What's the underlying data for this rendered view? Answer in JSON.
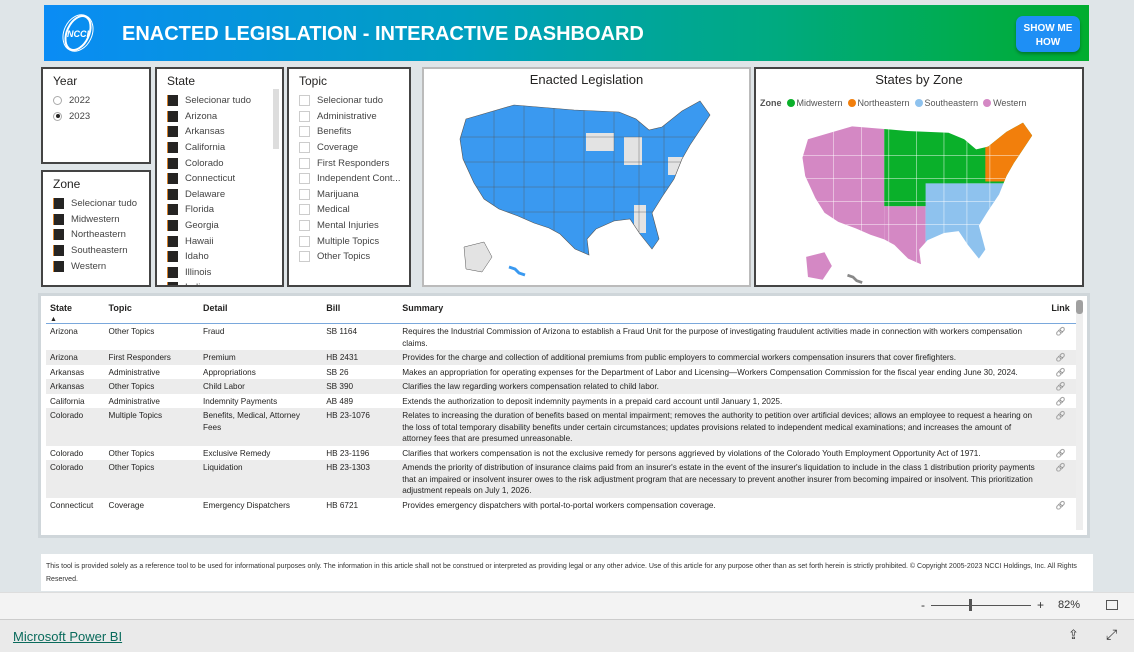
{
  "header": {
    "title": "ENACTED LEGISLATION - INTERACTIVE DASHBOARD",
    "logo_text": "NCCI",
    "show_me_line1": "SHOW ME",
    "show_me_line2": "HOW",
    "gradient_start": "#0a8cf5",
    "gradient_end": "#00ad2e"
  },
  "year": {
    "title": "Year",
    "options": [
      {
        "label": "2022",
        "selected": false
      },
      {
        "label": "2023",
        "selected": true
      }
    ]
  },
  "zone": {
    "title": "Zone",
    "items": [
      "Selecionar tudo",
      "Midwestern",
      "Northeastern",
      "Southeastern",
      "Western"
    ]
  },
  "state": {
    "title": "State",
    "items": [
      "Selecionar tudo",
      "Arizona",
      "Arkansas",
      "California",
      "Colorado",
      "Connecticut",
      "Delaware",
      "Florida",
      "Georgia",
      "Hawaii",
      "Idaho",
      "Illinois",
      "Indiana"
    ]
  },
  "topic": {
    "title": "Topic",
    "items": [
      "Selecionar tudo",
      "Administrative",
      "Benefits",
      "Coverage",
      "First Responders",
      "Independent Cont...",
      "Marijuana",
      "Medical",
      "Mental Injuries",
      "Multiple Topics",
      "Other Topics"
    ]
  },
  "enacted_map": {
    "title": "Enacted Legislation",
    "enacted_color": "#3a99f0",
    "not_enacted_color": "#e3e3e3"
  },
  "zone_map": {
    "title": "States by Zone",
    "legend_title": "Zone",
    "legend": [
      {
        "label": "Midwestern",
        "color": "#0ab02a"
      },
      {
        "label": "Northeastern",
        "color": "#f27f0c"
      },
      {
        "label": "Southeastern",
        "color": "#8ec2ee"
      },
      {
        "label": "Western",
        "color": "#d488c4"
      }
    ]
  },
  "table": {
    "headers": [
      "State",
      "Topic",
      "Detail",
      "Bill",
      "Summary",
      "Link"
    ],
    "sort_indicator": "▲",
    "rows": [
      {
        "state": "Arizona",
        "topic": "Other Topics",
        "detail": "Fraud",
        "bill": "SB 1164",
        "summary": "Requires the Industrial Commission of Arizona to establish a Fraud Unit for the purpose of investigating fraudulent activities made in connection with workers compensation claims."
      },
      {
        "state": "Arizona",
        "topic": "First Responders",
        "detail": "Premium",
        "bill": "HB 2431",
        "summary": "Provides for the charge and collection of additional premiums from public employers to commercial workers compensation insurers that cover firefighters."
      },
      {
        "state": "Arkansas",
        "topic": "Administrative",
        "detail": "Appropriations",
        "bill": "SB 26",
        "summary": "Makes an appropriation for operating expenses for the Department of Labor and Licensing—Workers Compensation Commission for the fiscal year ending June 30, 2024."
      },
      {
        "state": "Arkansas",
        "topic": "Other Topics",
        "detail": "Child Labor",
        "bill": "SB 390",
        "summary": "Clarifies the law regarding workers compensation related to child labor."
      },
      {
        "state": "California",
        "topic": "Administrative",
        "detail": "Indemnity Payments",
        "bill": "AB 489",
        "summary": "Extends the authorization to deposit indemnity payments in a prepaid card account until January 1, 2025."
      },
      {
        "state": "Colorado",
        "topic": "Multiple Topics",
        "detail": "Benefits, Medical, Attorney Fees",
        "bill": "HB 23-1076",
        "summary": "Relates to increasing the duration of benefits based on mental impairment; removes the authority to petition over artificial devices; allows an employee to request a hearing on the loss of total temporary disability benefits under certain circumstances; updates provisions related to independent medical examinations; and increases the amount of attorney fees that are presumed unreasonable."
      },
      {
        "state": "Colorado",
        "topic": "Other Topics",
        "detail": "Exclusive Remedy",
        "bill": "HB 23-1196",
        "summary": "Clarifies that workers compensation is not the exclusive remedy for persons aggrieved by violations of the Colorado Youth Employment Opportunity Act of 1971."
      },
      {
        "state": "Colorado",
        "topic": "Other Topics",
        "detail": "Liquidation",
        "bill": "HB 23-1303",
        "summary": "Amends the priority of distribution of insurance claims paid from an insurer's estate in the event of the insurer's liquidation to include in the class 1 distribution priority payments that an impaired or insolvent insurer owes to the risk adjustment program that are necessary to prevent another insurer from becoming impaired or insolvent. This prioritization adjustment repeals on July 1, 2026."
      },
      {
        "state": "Connecticut",
        "topic": "Coverage",
        "detail": "Emergency Dispatchers",
        "bill": "HB 6721",
        "summary": "Provides emergency dispatchers with portal-to-portal workers compensation coverage."
      }
    ]
  },
  "disclaimer": "This tool is provided solely as a reference tool to be used for informational purposes only.  The information in this article shall not be construed or interpreted as providing legal or any other advice. Use of this article for any purpose other than as set forth herein is strictly prohibited. © Copyright 2005-2023 NCCI Holdings, Inc. All Rights Reserved.",
  "zoom": {
    "minus": "-",
    "plus": "+",
    "level": "82%",
    "level_percent": 82
  },
  "footer": {
    "link": "Microsoft Power BI"
  }
}
